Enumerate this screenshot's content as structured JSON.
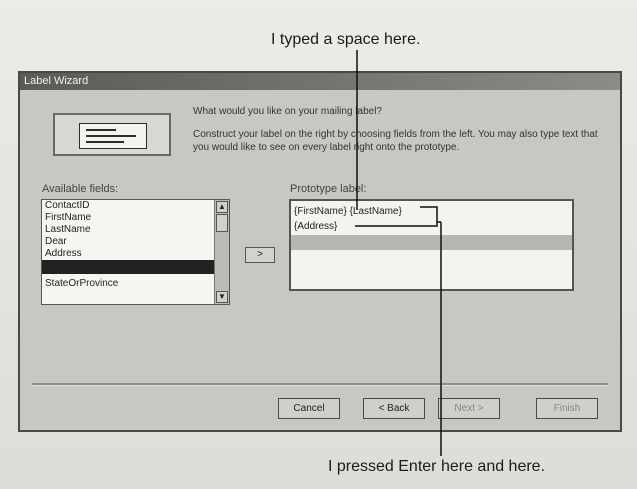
{
  "callouts": {
    "top": "I typed a space here.",
    "bottom": "I pressed Enter here and here."
  },
  "dialog": {
    "title": "Label Wizard",
    "question": "What would you like on your mailing label?",
    "instructions": "Construct your label on the right by choosing fields from the left. You may also type text that you would like to see on every label right onto the prototype.",
    "available_label": "Available fields:",
    "prototype_label": "Prototype label:",
    "fields": [
      "ContactID",
      "FirstName",
      "LastName",
      "Dear",
      "Address",
      "",
      "StateOrProvince"
    ],
    "add_button": ">",
    "prototype_lines": [
      "{FirstName} {LastName}",
      "{Address}",
      ""
    ],
    "buttons": {
      "cancel": "Cancel",
      "back": "< Back",
      "next": "Next >",
      "finish": "Finish"
    }
  }
}
